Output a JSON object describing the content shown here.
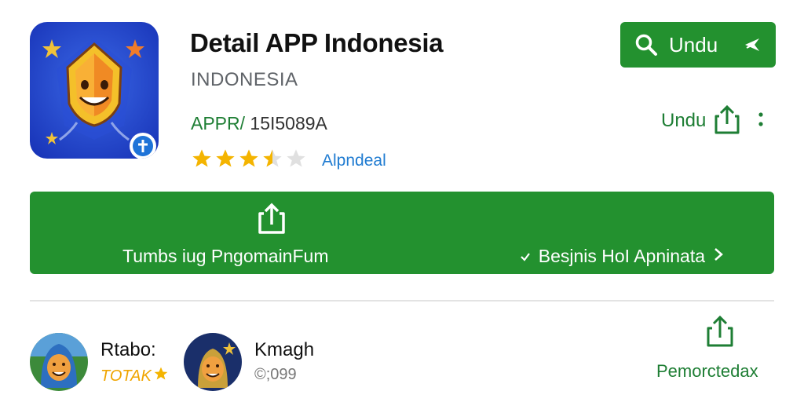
{
  "app": {
    "title": "Detail APP Indonesia",
    "subtitle": "INDONESIA",
    "id_prefix": "APPR/",
    "id_number": "15I5089A",
    "rating_value": 3.5,
    "rating_max": 5,
    "rating_label": "Alpndeal",
    "icon_name": "smiling-mask-icon"
  },
  "actions": {
    "install_label": "Undu",
    "share_label": "Undu"
  },
  "banner": {
    "left_text": "Tumbs iug PngomainFum",
    "right_text": "Besjnis HoI Apninata",
    "icon_name": "share-icon"
  },
  "reviews": [
    {
      "name": "Rtabo:",
      "sub": "TOTAK",
      "stars": 1
    },
    {
      "name": "Kmagh",
      "sub": "©;099"
    }
  ],
  "share_bottom_label": "Pemorctedax",
  "colors": {
    "primary_green": "#23912f",
    "text_green": "#1e7e34",
    "star_gold": "#f4b400",
    "link_blue": "#1f7bd1",
    "icon_blue": "#1e40c8"
  }
}
